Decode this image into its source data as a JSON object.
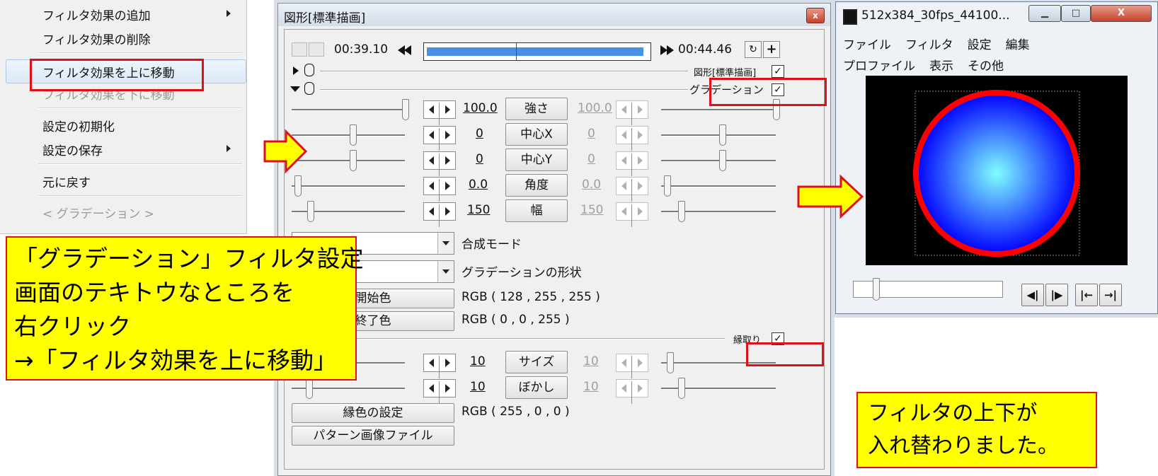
{
  "context_menu": {
    "items": [
      {
        "label": "フィルタ効果の追加",
        "has_submenu": true,
        "disabled": false
      },
      {
        "label": "フィルタ効果の削除",
        "has_submenu": false,
        "disabled": false
      },
      {
        "label": "フィルタ効果を上に移動",
        "has_submenu": false,
        "disabled": false
      },
      {
        "label": "フィルタ効果を下に移動",
        "has_submenu": false,
        "disabled": true
      },
      {
        "label": "設定の初期化",
        "has_submenu": false,
        "disabled": false
      },
      {
        "label": "設定の保存",
        "has_submenu": true,
        "disabled": false
      },
      {
        "label": "元に戻す",
        "has_submenu": false,
        "disabled": false
      },
      {
        "label": "< グラデーション >",
        "has_submenu": false,
        "disabled": true
      }
    ]
  },
  "main_window": {
    "title": "図形[標準描画]",
    "close_glyph": "x",
    "timeline": {
      "start_time": "00:39.10",
      "end_time": "00:44.46"
    },
    "filter_rows": [
      {
        "label": "図形[標準描画]",
        "checked": true
      },
      {
        "label": "グラデーション",
        "checked": true
      }
    ],
    "params": [
      {
        "name": "強さ",
        "left_value": "100.0",
        "right_value": "100.0"
      },
      {
        "name": "中心X",
        "left_value": "0",
        "right_value": "0"
      },
      {
        "name": "中心Y",
        "left_value": "0",
        "right_value": "0"
      },
      {
        "name": "角度",
        "left_value": "0.0",
        "right_value": "0.0"
      },
      {
        "name": "幅",
        "left_value": "150",
        "right_value": "150"
      }
    ],
    "blend_mode_label": "合成モード",
    "shape_label": "グラデーションの形状",
    "start_color_button": "開始色",
    "start_color_value": "RGB ( 128 , 255 , 255 )",
    "end_color_button": "終了色",
    "end_color_value": "RGB ( 0 , 0 , 255 )",
    "border_filter": {
      "label": "縁取り",
      "checked": true
    },
    "border_params": [
      {
        "name": "サイズ",
        "left_value": "10",
        "right_value": "10"
      },
      {
        "name": "ぼかし",
        "left_value": "10",
        "right_value": "10"
      }
    ],
    "border_color_button": "縁色の設定",
    "border_color_value": "RGB ( 255 , 0 , 0 )",
    "pattern_button": "パターン画像ファイル",
    "check_glyph": "✓"
  },
  "preview_window": {
    "title": "512x384_30fps_44100...",
    "menu_row1": [
      "ファイル",
      "フィルタ",
      "設定",
      "編集"
    ],
    "menu_row2": [
      "プロファイル",
      "表示",
      "その他"
    ]
  },
  "callouts": {
    "instruction_lines": [
      "「グラデーション」フィルタ設定",
      "画面のテキトウなところを",
      "右クリック",
      "→「フィルタ効果を上に移動」"
    ],
    "result_lines": [
      "フィルタの上下が",
      "入れ替わりました。"
    ]
  },
  "colors": {
    "highlight_red": "#e0101a",
    "callout_yellow": "#ffff00",
    "timeline_blue": "#4a8fe6",
    "gradient_center": "#80ffff",
    "gradient_edge": "#0000ff",
    "border_red": "#ff0000"
  }
}
